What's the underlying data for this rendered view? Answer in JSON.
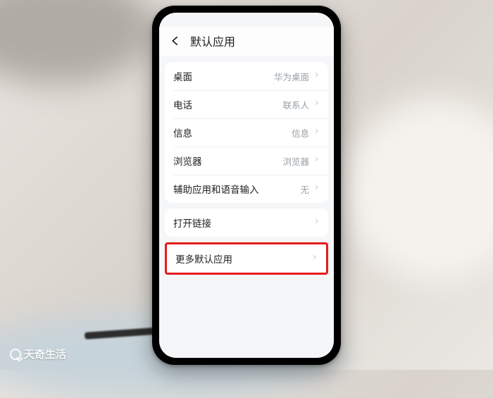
{
  "watermark": "天奇生活",
  "header": {
    "title": "默认应用"
  },
  "group1": [
    {
      "label": "桌面",
      "value": "华为桌面"
    },
    {
      "label": "电话",
      "value": "联系人"
    },
    {
      "label": "信息",
      "value": "信息"
    },
    {
      "label": "浏览器",
      "value": "浏览器"
    },
    {
      "label": "辅助应用和语音输入",
      "value": "无"
    }
  ],
  "group2": [
    {
      "label": "打开链接",
      "value": ""
    }
  ],
  "group3": [
    {
      "label": "更多默认应用",
      "value": ""
    }
  ]
}
